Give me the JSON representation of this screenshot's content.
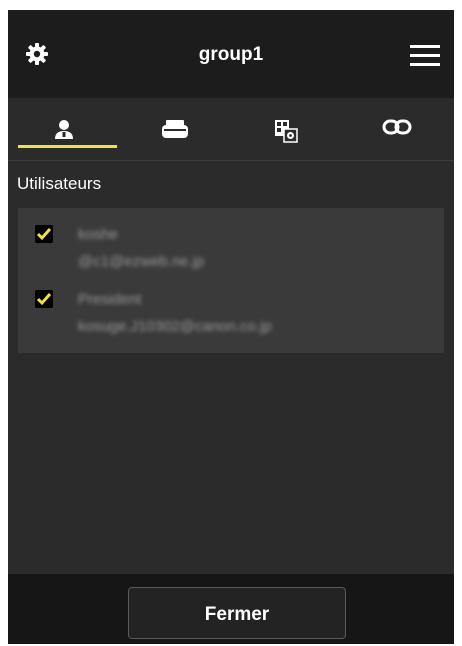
{
  "header": {
    "title": "group1",
    "left_icon": "gear-icon",
    "right_icon": "hamburger-menu-icon"
  },
  "tabs": [
    {
      "icon": "user-icon",
      "selected": true
    },
    {
      "icon": "printer-icon",
      "selected": false
    },
    {
      "icon": "app-settings-icon",
      "selected": false
    },
    {
      "icon": "link-icon",
      "selected": false
    }
  ],
  "section": {
    "title": "Utilisateurs"
  },
  "users": [
    {
      "name": "koshe",
      "email": "@c1@ezweb.ne.jp",
      "checked": true
    },
    {
      "name": "President",
      "email": "kosuge.J10302@canon.co.jp",
      "checked": true
    }
  ],
  "footer": {
    "close_label": "Fermer"
  },
  "colors": {
    "accent": "#f0e04a",
    "background": "#2b2b2b",
    "header": "#1c1c1c",
    "card": "#3a3a3a"
  }
}
